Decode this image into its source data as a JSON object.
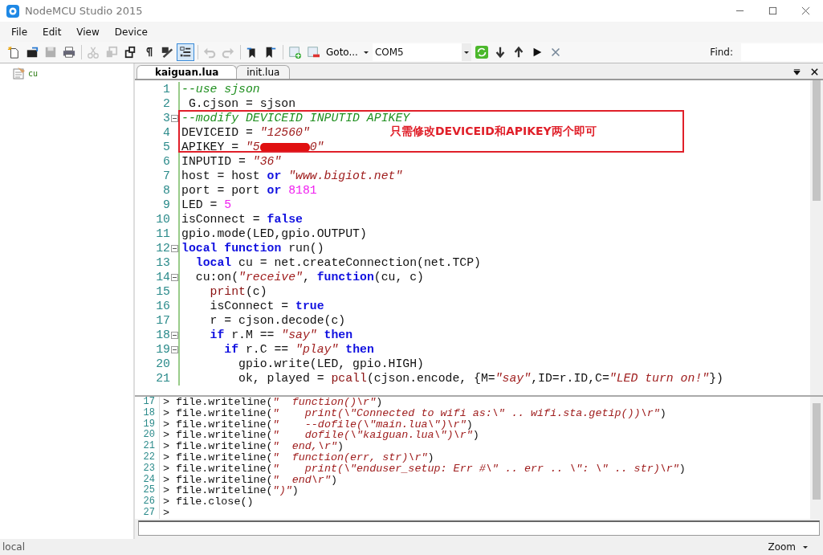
{
  "window": {
    "title": "NodeMCU Studio 2015"
  },
  "menu": [
    "File",
    "Edit",
    "View",
    "Device"
  ],
  "toolbar": {
    "buttons": [
      {
        "kind": "new",
        "on": false,
        "disabled": false
      },
      {
        "kind": "open",
        "on": false,
        "disabled": false
      },
      {
        "kind": "save",
        "on": false,
        "disabled": true
      },
      {
        "kind": "print",
        "on": false,
        "disabled": false
      },
      {
        "kind": "sep"
      },
      {
        "kind": "cut",
        "on": false,
        "disabled": true
      },
      {
        "kind": "copy",
        "on": false,
        "disabled": true
      },
      {
        "kind": "paste",
        "on": false,
        "disabled": false
      },
      {
        "kind": "pilcrow",
        "on": false,
        "disabled": false
      },
      {
        "kind": "spell",
        "on": false,
        "disabled": false
      },
      {
        "kind": "outline",
        "on": true,
        "disabled": false
      },
      {
        "kind": "sep"
      },
      {
        "kind": "undo",
        "on": false,
        "disabled": true
      },
      {
        "kind": "redo",
        "on": false,
        "disabled": true
      },
      {
        "kind": "sep"
      },
      {
        "kind": "bookprev",
        "on": false,
        "disabled": false
      },
      {
        "kind": "booknext",
        "on": false,
        "disabled": false
      },
      {
        "kind": "sep"
      },
      {
        "kind": "add",
        "on": false,
        "disabled": false
      },
      {
        "kind": "remove",
        "on": false,
        "disabled": false
      }
    ],
    "goto": "Goto...",
    "port": "COM5",
    "device_buttons": [
      {
        "kind": "refresh"
      },
      {
        "kind": "down"
      },
      {
        "kind": "up"
      },
      {
        "kind": "run"
      },
      {
        "kind": "stop"
      }
    ],
    "find_label": "Find:"
  },
  "tree": [
    {
      "label": "cu"
    }
  ],
  "tabs": [
    {
      "label": "kaiguan.lua",
      "selected": true
    },
    {
      "label": "init.lua",
      "selected": false
    }
  ],
  "editor": {
    "lines": [
      {
        "no": "1",
        "fold": false,
        "tokens": [
          {
            "kind": "comment",
            "text": "--use sjson"
          }
        ]
      },
      {
        "no": "2",
        "fold": false,
        "tokens": [
          {
            "kind": "plain",
            "text": " G.cjson = sjson"
          }
        ]
      },
      {
        "no": "3",
        "fold": true,
        "tokens": [
          {
            "kind": "comment",
            "text": "--modify DEVICEID INPUTID APIKEY"
          }
        ]
      },
      {
        "no": "4",
        "fold": false,
        "tokens": [
          {
            "kind": "plain",
            "text": "DEVICEID = "
          },
          {
            "kind": "string",
            "text": "\"12560\""
          }
        ]
      },
      {
        "no": "5",
        "fold": false,
        "tokens": [
          {
            "kind": "plain",
            "text": "APIKEY = "
          },
          {
            "kind": "string",
            "text": "\"5"
          },
          {
            "kind": "redacted"
          },
          {
            "kind": "string",
            "text": "0\""
          }
        ]
      },
      {
        "no": "6",
        "fold": false,
        "tokens": [
          {
            "kind": "plain",
            "text": "INPUTID = "
          },
          {
            "kind": "string",
            "text": "\"36\""
          }
        ]
      },
      {
        "no": "7",
        "fold": false,
        "tokens": [
          {
            "kind": "plain",
            "text": "host = host "
          },
          {
            "kind": "keyword",
            "text": "or"
          },
          {
            "kind": "string",
            "text": " \"www.bigiot.net\""
          }
        ]
      },
      {
        "no": "8",
        "fold": false,
        "tokens": [
          {
            "kind": "plain",
            "text": "port = port "
          },
          {
            "kind": "keyword",
            "text": "or"
          },
          {
            "kind": "number",
            "text": " 8181"
          }
        ]
      },
      {
        "no": "9",
        "fold": false,
        "tokens": [
          {
            "kind": "plain",
            "text": "LED = "
          },
          {
            "kind": "number",
            "text": "5"
          }
        ]
      },
      {
        "no": "10",
        "fold": false,
        "tokens": [
          {
            "kind": "plain",
            "text": "isConnect = "
          },
          {
            "kind": "keyword",
            "text": "false"
          }
        ]
      },
      {
        "no": "11",
        "fold": false,
        "tokens": [
          {
            "kind": "plain",
            "text": "gpio.mode(LED,gpio.OUTPUT)"
          }
        ]
      },
      {
        "no": "12",
        "fold": true,
        "tokens": [
          {
            "kind": "keyword",
            "text": "local function"
          },
          {
            "kind": "plain",
            "text": " run()"
          }
        ]
      },
      {
        "no": "13",
        "fold": false,
        "tokens": [
          {
            "kind": "keyword",
            "text": "  local"
          },
          {
            "kind": "plain",
            "text": " cu = net.createConnection(net.TCP)"
          }
        ]
      },
      {
        "no": "14",
        "fold": true,
        "tokens": [
          {
            "kind": "plain",
            "text": "  cu:on("
          },
          {
            "kind": "string",
            "text": "\"receive\""
          },
          {
            "kind": "plain",
            "text": ", "
          },
          {
            "kind": "keyword",
            "text": "function"
          },
          {
            "kind": "plain",
            "text": "(cu, c)"
          }
        ]
      },
      {
        "no": "15",
        "fold": false,
        "tokens": [
          {
            "kind": "builtin",
            "text": "    print"
          },
          {
            "kind": "plain",
            "text": "(c)"
          }
        ]
      },
      {
        "no": "16",
        "fold": false,
        "tokens": [
          {
            "kind": "plain",
            "text": "    isConnect = "
          },
          {
            "kind": "keyword",
            "text": "true"
          }
        ]
      },
      {
        "no": "17",
        "fold": false,
        "tokens": [
          {
            "kind": "plain",
            "text": "    r = cjson.decode(c)"
          }
        ]
      },
      {
        "no": "18",
        "fold": true,
        "tokens": [
          {
            "kind": "keyword",
            "text": "    if"
          },
          {
            "kind": "plain",
            "text": " r.M == "
          },
          {
            "kind": "string",
            "text": "\"say\""
          },
          {
            "kind": "keyword",
            "text": " then"
          }
        ]
      },
      {
        "no": "19",
        "fold": true,
        "tokens": [
          {
            "kind": "keyword",
            "text": "      if"
          },
          {
            "kind": "plain",
            "text": " r.C == "
          },
          {
            "kind": "string",
            "text": "\"play\""
          },
          {
            "kind": "keyword",
            "text": " then"
          }
        ]
      },
      {
        "no": "20",
        "fold": false,
        "tokens": [
          {
            "kind": "plain",
            "text": "        gpio.write(LED, gpio.HIGH)"
          }
        ]
      },
      {
        "no": "21",
        "fold": false,
        "tokens": [
          {
            "kind": "plain",
            "text": "        ok, played = "
          },
          {
            "kind": "builtin",
            "text": "pcall"
          },
          {
            "kind": "plain",
            "text": "(cjson.encode, {M="
          },
          {
            "kind": "string",
            "text": "\"say\""
          },
          {
            "kind": "plain",
            "text": ",ID=r.ID,C="
          },
          {
            "kind": "string",
            "text": "\"LED turn on!\""
          },
          {
            "kind": "plain",
            "text": "})"
          }
        ]
      }
    ],
    "annotation": "只需修改DEVICEID和APIKEY两个即可"
  },
  "console": {
    "lines": [
      {
        "no": "17",
        "tokens": [
          {
            "kind": "plain",
            "text": "> file.writeline("
          },
          {
            "kind": "string",
            "text": "\"  function()\\r\""
          },
          {
            "kind": "plain",
            "text": ")"
          }
        ]
      },
      {
        "no": "18",
        "tokens": [
          {
            "kind": "plain",
            "text": "> file.writeline("
          },
          {
            "kind": "string",
            "text": "\"    print(\\\"Connected to wifi as:\\\" .. wifi.sta.getip())\\r\""
          },
          {
            "kind": "plain",
            "text": ")"
          }
        ]
      },
      {
        "no": "19",
        "tokens": [
          {
            "kind": "plain",
            "text": "> file.writeline("
          },
          {
            "kind": "string",
            "text": "\"    --dofile(\\\"main.lua\\\")\\r\""
          },
          {
            "kind": "plain",
            "text": ")"
          }
        ]
      },
      {
        "no": "20",
        "tokens": [
          {
            "kind": "plain",
            "text": "> file.writeline("
          },
          {
            "kind": "string",
            "text": "\"    dofile(\\\"kaiguan.lua\\\")\\r\""
          },
          {
            "kind": "plain",
            "text": ")"
          }
        ]
      },
      {
        "no": "21",
        "tokens": [
          {
            "kind": "plain",
            "text": "> file.writeline("
          },
          {
            "kind": "string",
            "text": "\"  end,\\r\""
          },
          {
            "kind": "plain",
            "text": ")"
          }
        ]
      },
      {
        "no": "22",
        "tokens": [
          {
            "kind": "plain",
            "text": "> file.writeline("
          },
          {
            "kind": "string",
            "text": "\"  function(err, str)\\r\""
          },
          {
            "kind": "plain",
            "text": ")"
          }
        ]
      },
      {
        "no": "23",
        "tokens": [
          {
            "kind": "plain",
            "text": "> file.writeline("
          },
          {
            "kind": "string",
            "text": "\"    print(\\\"enduser_setup: Err #\\\" .. err .. \\\": \\\" .. str)\\r\""
          },
          {
            "kind": "plain",
            "text": ")"
          }
        ]
      },
      {
        "no": "24",
        "tokens": [
          {
            "kind": "plain",
            "text": "> file.writeline("
          },
          {
            "kind": "string",
            "text": "\"  end\\r\""
          },
          {
            "kind": "plain",
            "text": ")"
          }
        ]
      },
      {
        "no": "25",
        "tokens": [
          {
            "kind": "plain",
            "text": "> file.writeline("
          },
          {
            "kind": "string",
            "text": "\")\""
          },
          {
            "kind": "plain",
            "text": ")"
          }
        ]
      },
      {
        "no": "26",
        "tokens": [
          {
            "kind": "plain",
            "text": "> file.close()"
          }
        ]
      },
      {
        "no": "27",
        "tokens": [
          {
            "kind": "plain",
            "text": ">"
          }
        ]
      }
    ]
  },
  "status_bar": {
    "left": "local",
    "zoom": "Zoom"
  }
}
